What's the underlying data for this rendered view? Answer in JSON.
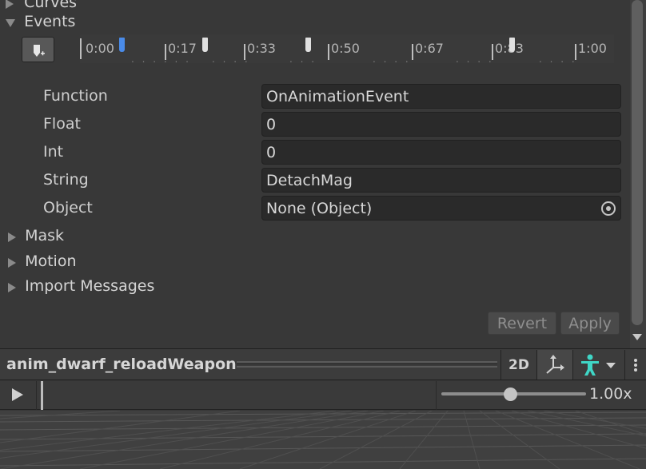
{
  "inspector": {
    "curves_label": "Curves",
    "events_label": "Events",
    "timeline": {
      "labels": [
        "0:00",
        "0:17",
        "0:33",
        "0:50",
        "0:67",
        "0:83",
        "1:00"
      ],
      "selected_event_time": "0:00",
      "marker_color_selected": "#4a8be8",
      "marker_color_default": "#e0e0e0"
    },
    "fields": {
      "function_label": "Function",
      "function_value": "OnAnimationEvent",
      "float_label": "Float",
      "float_value": "0",
      "int_label": "Int",
      "int_value": "0",
      "string_label": "String",
      "string_value": "DetachMag",
      "object_label": "Object",
      "object_value": "None (Object)"
    },
    "sections": {
      "mask": "Mask",
      "motion": "Motion",
      "import_messages": "Import Messages"
    },
    "buttons": {
      "revert": "Revert",
      "apply": "Apply"
    }
  },
  "preview": {
    "title": "anim_dwarf_reloadWeapon",
    "mode_2d": "2D",
    "speed": "1.00x",
    "speed_slider_value": 0.5,
    "avatar_icon_color": "#3fd6c6"
  }
}
